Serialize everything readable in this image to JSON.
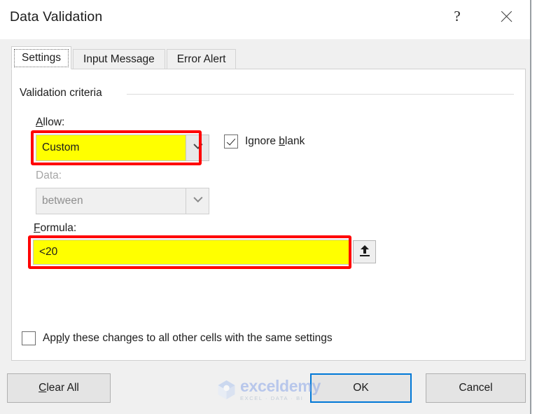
{
  "window": {
    "title": "Data Validation",
    "help_label": "?",
    "close_label": "✕"
  },
  "tabs": [
    {
      "label": "Settings",
      "active": true
    },
    {
      "label": "Input Message",
      "active": false
    },
    {
      "label": "Error Alert",
      "active": false
    }
  ],
  "settings": {
    "group_title": "Validation criteria",
    "allow": {
      "label_prefix": "",
      "label_accel": "A",
      "label_suffix": "llow:",
      "value": "Custom",
      "highlight_color": "#ffff00",
      "annotation_color": "#ff0000"
    },
    "ignore_blank": {
      "label_prefix": "Ignore ",
      "label_accel": "b",
      "label_suffix": "lank",
      "checked": true
    },
    "data": {
      "label": "Data:",
      "value": "between",
      "disabled": true
    },
    "formula": {
      "label_accel": "F",
      "label_suffix": "ormula:",
      "value": "<20",
      "highlight_color": "#ffff00",
      "annotation_color": "#ff0000",
      "picker_icon": "range-select-up-arrow-icon"
    },
    "apply_all": {
      "label_prefix": "Ap",
      "label_accel": "p",
      "label_suffix": "ly these changes to all other cells with the same settings",
      "checked": false
    }
  },
  "footer": {
    "clear_all": {
      "accel": "C",
      "suffix": "lear All"
    },
    "ok": "OK",
    "cancel": "Cancel",
    "ok_focus_color": "#0078d7"
  },
  "watermark": {
    "name": "exceldemy",
    "tagline": "EXCEL · DATA · BI"
  }
}
